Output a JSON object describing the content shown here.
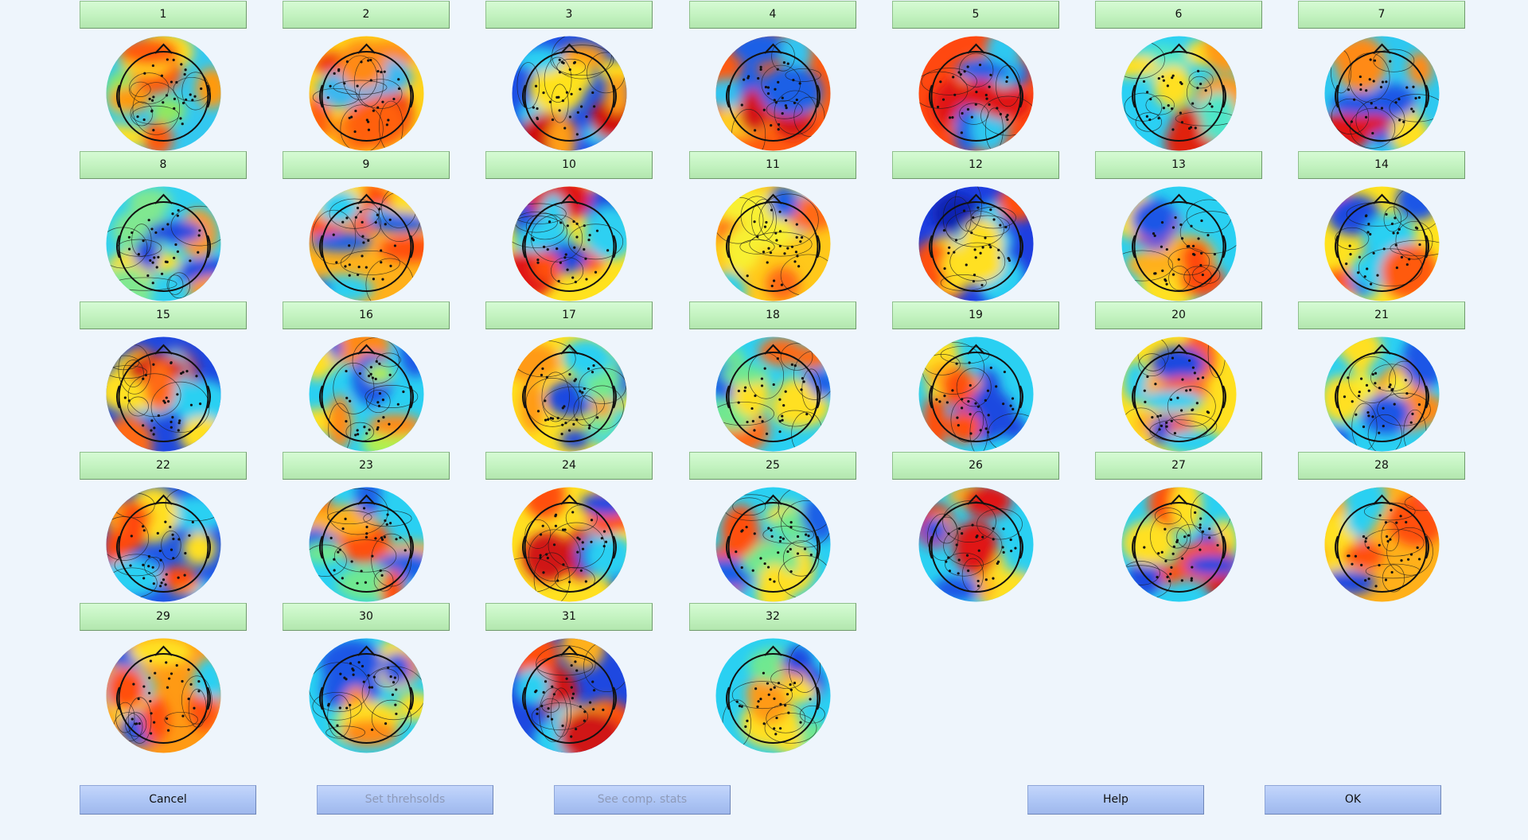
{
  "components": [
    {
      "label": "1",
      "colors": [
        "#33c8f0",
        "#ff9a10",
        "#ffe020",
        "#ff5a10",
        "#8fe860"
      ]
    },
    {
      "label": "2",
      "colors": [
        "#ffd21a",
        "#ff6010",
        "#3ab8f0",
        "#ff8a15",
        "#f04010"
      ]
    },
    {
      "label": "3",
      "colors": [
        "#1e50e6",
        "#2ad0f2",
        "#ff9e12",
        "#ffe21e",
        "#d01010"
      ]
    },
    {
      "label": "4",
      "colors": [
        "#ff5a10",
        "#30c4f0",
        "#d41818",
        "#1e60e6",
        "#ffcc20"
      ]
    },
    {
      "label": "5",
      "colors": [
        "#ff4810",
        "#1e60e6",
        "#2ec8f0",
        "#e01818",
        "#ff9a14"
      ]
    },
    {
      "label": "6",
      "colors": [
        "#2ad0f4",
        "#ffe020",
        "#ff9a14",
        "#50e6c8",
        "#e02010"
      ]
    },
    {
      "label": "7",
      "colors": [
        "#2ec8f0",
        "#1e56e6",
        "#ff8a14",
        "#e01818",
        "#ffe020"
      ]
    },
    {
      "label": "8",
      "colors": [
        "#30d0f0",
        "#ffe020",
        "#1e48e0",
        "#80e890",
        "#ff9a14"
      ]
    },
    {
      "label": "9",
      "colors": [
        "#ffb01a",
        "#1e60e6",
        "#ff5010",
        "#2ad0f2",
        "#ffe020"
      ]
    },
    {
      "label": "10",
      "colors": [
        "#ffe21e",
        "#1e48e0",
        "#ff5010",
        "#2ed0f2",
        "#e01818"
      ]
    },
    {
      "label": "11",
      "colors": [
        "#ffc81a",
        "#2ad0f2",
        "#ff6a12",
        "#f8f030",
        "#1e60e6"
      ]
    },
    {
      "label": "12",
      "colors": [
        "#1e3ee0",
        "#2ad0f2",
        "#ff5010",
        "#ffe020",
        "#0a20b0"
      ]
    },
    {
      "label": "13",
      "colors": [
        "#2ad0f2",
        "#ffb01a",
        "#1e56e6",
        "#ff4a10",
        "#ffe020"
      ]
    },
    {
      "label": "14",
      "colors": [
        "#ffe21e",
        "#1e56e6",
        "#2ad0f2",
        "#ff5a10",
        "#1e48e0"
      ]
    },
    {
      "label": "15",
      "colors": [
        "#1e48e0",
        "#ff6a12",
        "#2ad0f2",
        "#ffe020",
        "#d01818"
      ]
    },
    {
      "label": "16",
      "colors": [
        "#2ad0f2",
        "#ffe020",
        "#ff8a14",
        "#1e56e6",
        "#b0f050"
      ]
    },
    {
      "label": "17",
      "colors": [
        "#ffe020",
        "#2ad0f2",
        "#1e48e0",
        "#ff9a14",
        "#70e890"
      ]
    },
    {
      "label": "18",
      "colors": [
        "#2ad0f2",
        "#ffe020",
        "#ff6a12",
        "#70e890",
        "#1e60e6"
      ]
    },
    {
      "label": "19",
      "colors": [
        "#2ad0f2",
        "#1e48e0",
        "#ffb01a",
        "#ff5010",
        "#ffe020"
      ]
    },
    {
      "label": "20",
      "colors": [
        "#ffe020",
        "#1e48e0",
        "#ff5a10",
        "#2ad0f2",
        "#ffb01a"
      ]
    },
    {
      "label": "21",
      "colors": [
        "#2ad0f2",
        "#ffe020",
        "#ff8a14",
        "#1e56e6",
        "#f8f030"
      ]
    },
    {
      "label": "22",
      "colors": [
        "#1e56e6",
        "#ff9a14",
        "#2ad0f2",
        "#ff4810",
        "#ffe020"
      ]
    },
    {
      "label": "23",
      "colors": [
        "#2ad0f2",
        "#ffb01a",
        "#1e60e6",
        "#ff5010",
        "#70e890"
      ]
    },
    {
      "label": "24",
      "colors": [
        "#ffe020",
        "#2ad0f2",
        "#ff5010",
        "#1e48e0",
        "#d01818"
      ]
    },
    {
      "label": "25",
      "colors": [
        "#2ad0f2",
        "#ffe020",
        "#ff5010",
        "#1e60e6",
        "#70e890"
      ]
    },
    {
      "label": "26",
      "colors": [
        "#2ad0f2",
        "#ffb01a",
        "#e01818",
        "#1e56e6",
        "#ffe020"
      ]
    },
    {
      "label": "27",
      "colors": [
        "#2ad0f2",
        "#ff5010",
        "#1e48e0",
        "#ffe020",
        "#d01818"
      ]
    },
    {
      "label": "28",
      "colors": [
        "#ffb01a",
        "#2ad0f2",
        "#1e48e0",
        "#ff5010",
        "#ffe020"
      ]
    },
    {
      "label": "29",
      "colors": [
        "#ff9a14",
        "#2ad0f2",
        "#ffe020",
        "#ff5010",
        "#1e56e6"
      ]
    },
    {
      "label": "30",
      "colors": [
        "#2ad0f2",
        "#ffe020",
        "#1e56e6",
        "#ff8a14",
        "#80e890"
      ]
    },
    {
      "label": "31",
      "colors": [
        "#1e48e0",
        "#ff5010",
        "#2ad0f2",
        "#ffb01a",
        "#d01818"
      ]
    },
    {
      "label": "32",
      "colors": [
        "#2ad0f2",
        "#ffe020",
        "#ff9a14",
        "#1e48e0",
        "#70e890"
      ]
    }
  ],
  "buttons": {
    "cancel": "Cancel",
    "set_thresholds": "Set threhsolds",
    "see_comp_stats": "See comp. stats",
    "help": "Help",
    "ok": "OK"
  },
  "colors": {
    "background": "#eef5fc",
    "component_button": "#c2f2bf",
    "action_button": "#adc5f5",
    "disabled_text": "#8e9ab8"
  }
}
